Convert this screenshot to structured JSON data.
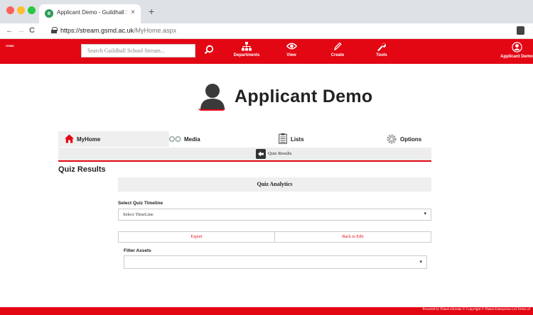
{
  "browser": {
    "tab_title": "Applicant Demo - Guildhall Sc",
    "tab_close": "×",
    "new_tab": "+",
    "url_host": "https://stream.gsmd.ac.uk",
    "url_path": "/MyHome.aspx",
    "back": "←",
    "forward": "→",
    "reload": "C",
    "menu": "⋮"
  },
  "header": {
    "logo_text": "GSMD",
    "search_placeholder": "Search Guildhall School Stream...",
    "nav": [
      {
        "label": "Departments",
        "icon": "sitemap-icon"
      },
      {
        "label": "View",
        "icon": "eye-icon"
      },
      {
        "label": "Create",
        "icon": "pencil-icon"
      },
      {
        "label": "Tools",
        "icon": "wrench-icon"
      }
    ],
    "user_label": "Applicant Demo"
  },
  "profile": {
    "name": "Applicant Demo"
  },
  "tabs": [
    {
      "label": "MyHome",
      "icon": "house-icon",
      "active": true
    },
    {
      "label": "Media",
      "icon": "media-icon",
      "active": false
    },
    {
      "label": "Lists",
      "icon": "list-icon",
      "active": false
    },
    {
      "label": "Options",
      "icon": "cog-icon",
      "active": false
    }
  ],
  "subtab": {
    "label": "Quiz Results"
  },
  "page": {
    "heading": "Quiz Results",
    "panel_title": "Quiz Analytics",
    "timeline_label": "Select Quiz Timeline",
    "timeline_value": "Select TimeLine",
    "export_label": "Export",
    "back_label": "Back to Edit",
    "filter_label": "Filter Assets",
    "filter_value": ""
  },
  "footer": {
    "text": "Powered by Planet eStream © Copyright © Planet Enterprises Ltd  Terms of"
  },
  "colors": {
    "brand_red": "#e30613",
    "panel_gray": "#efefef"
  }
}
